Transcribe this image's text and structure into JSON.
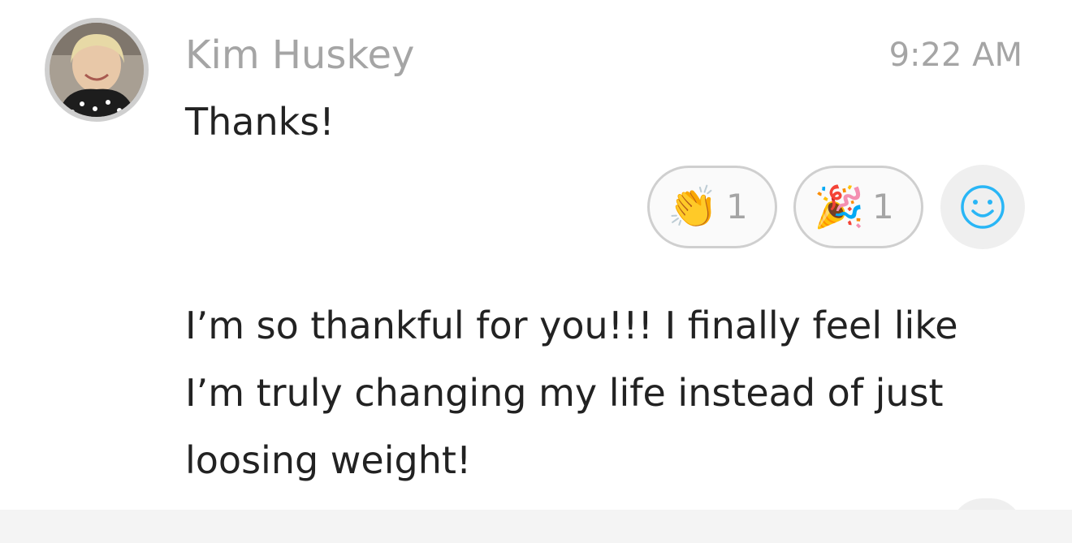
{
  "message": {
    "author": "Kim Huskey",
    "time": "9:22 AM",
    "text": "Thanks!"
  },
  "reactions": [
    {
      "emoji": "👏",
      "icon": "clapping-hands-icon",
      "count": "1"
    },
    {
      "emoji": "🎉",
      "icon": "party-popper-icon",
      "count": "1"
    }
  ],
  "add_reaction": {
    "icon": "smiley-icon",
    "color": "#29b6f6"
  },
  "next_message": {
    "lines": [
      "I’m so thankful for you!!! I finally feel like",
      "I’m truly changing my life instead of just",
      "loosing weight!"
    ]
  }
}
